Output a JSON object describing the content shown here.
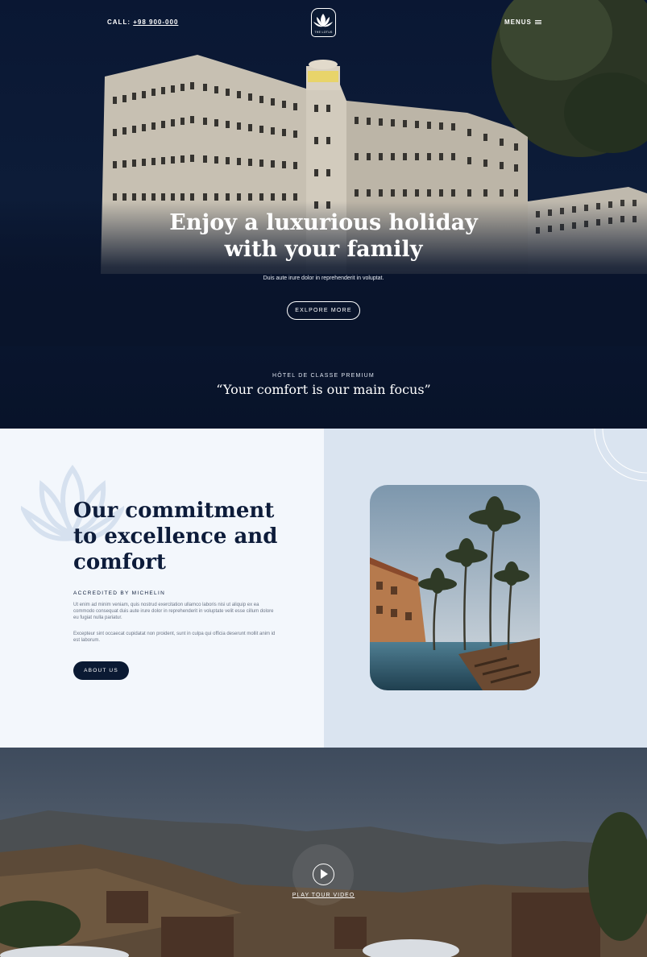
{
  "header": {
    "call_label": "CALL:",
    "phone": "+98 900-000",
    "logo_text": "THE LOTUS",
    "menus_label": "MENUS"
  },
  "hero": {
    "title_line1": "Enjoy a luxurious holiday",
    "title_line2": "with your family",
    "subtitle": "Duis aute irure dolor in reprehenderit in voluptat.",
    "cta_label": "EXLPORE MORE",
    "premium_label": "HÔTEL DE CLASSE PREMIUM",
    "premium_quote": "“Your comfort is our main focus”"
  },
  "commitment": {
    "title_line1": "Our commitment",
    "title_line2": "to excellence and",
    "title_line3": "comfort",
    "accredited": "ACCREDITED BY MICHELIN",
    "paragraph1": "Ut enim ad minim veniam, quis nostrud exercitation ullamco laboris nisi ut aliquip ex ea commodo consequat duis aute irure dolor in reprehenderit in voluptate velit esse cillum dolore eu fugiat nulla pariatur.",
    "paragraph2": "Excepteur sint occaecat cupidatat non proident, sunt in culpa qui officia deserunt mollit anim id est laborum.",
    "button_label": "ABOUT US"
  },
  "video": {
    "play_label": "PLAY TOUR VIDEO"
  },
  "colors": {
    "navy": "#0b1a33",
    "light_panel": "#f3f7fc",
    "blue_panel": "#dae4f0"
  }
}
